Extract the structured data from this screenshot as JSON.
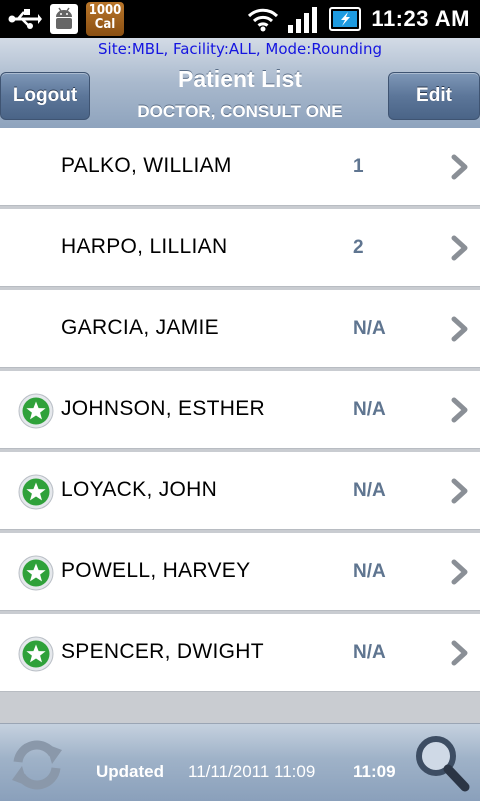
{
  "status_bar": {
    "cal_line1": "1000",
    "cal_line2": "Cal",
    "time": "11:23 AM",
    "icons": [
      "usb-icon",
      "android-debug-icon",
      "calorie-app-icon",
      "wifi-icon",
      "signal-icon",
      "battery-charging-icon"
    ]
  },
  "header": {
    "site_info": "Site:MBL, Facility:ALL, Mode:Rounding",
    "title": "Patient List",
    "subtitle": "DOCTOR, CONSULT ONE",
    "logout_label": "Logout",
    "edit_label": "Edit"
  },
  "patients": [
    {
      "name": "PALKO, WILLIAM",
      "bed": "1",
      "starred": false
    },
    {
      "name": "HARPO, LILLIAN",
      "bed": "2",
      "starred": false
    },
    {
      "name": "GARCIA, JAMIE",
      "bed": "N/A",
      "starred": false
    },
    {
      "name": "JOHNSON, ESTHER",
      "bed": "N/A",
      "starred": true
    },
    {
      "name": "LOYACK, JOHN",
      "bed": "N/A",
      "starred": true
    },
    {
      "name": "POWELL, HARVEY",
      "bed": "N/A",
      "starred": true
    },
    {
      "name": "SPENCER, DWIGHT",
      "bed": "N/A",
      "starred": true
    }
  ],
  "footer": {
    "updated_label": "Updated",
    "updated_timestamp": "11/11/2011 11:09",
    "time": "11:09"
  },
  "colors": {
    "header_blue": "#8ea3bd",
    "site_text": "#1515e0",
    "bed_text": "#5f7590",
    "star_green": "#2fa13a"
  }
}
